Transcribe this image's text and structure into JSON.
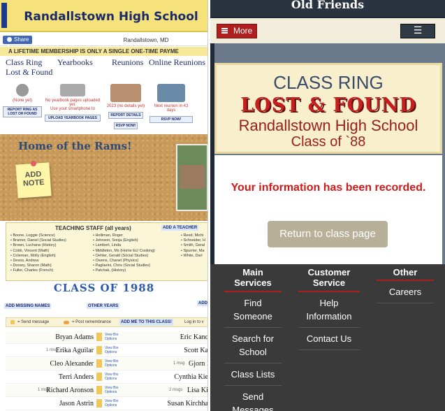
{
  "left": {
    "title": "Randallstown High School",
    "share_label": "Share 0",
    "city": "Randallstown, MD",
    "lifetime": "A LIFETIME MEMBERSHIP IS ONLY A SINGLE ONE-TIME PAYME",
    "nav": [
      "Class Ring",
      "Lost & Found",
      "Yearbooks",
      "Reunions",
      "Online Reunions"
    ],
    "icons": [
      {
        "caption": "(None yet)",
        "button": "REPORT RING AS LOST OR FOUND"
      },
      {
        "caption": "No yearbook pages uploaded yet.",
        "caption2": "Use your smartphone to",
        "button": "UPLOAD YEARBOOK PAGES"
      },
      {
        "caption": "2023 (no details yet)",
        "button": "REPORT DETAILS",
        "button2": "RSVP NOW!"
      },
      {
        "caption": "Next reunion in 43 days",
        "button": "RSVP NOW!"
      }
    ],
    "home_title": "Home of the Rams!",
    "add_note": "ADD NOTE",
    "teaching_title": "TEACHING STAFF (all years)",
    "add_teacher": "ADD A TEACHER",
    "teachers_col1": [
      "• Boone, Leggie (Science)",
      "• Bramer, Daniel (Social Studies)",
      "• Brown, Luchana (History)",
      "• Cobb, Vincent (Math)",
      "• Coleman, Molly (English)",
      "• Devos, Andrew",
      "• Dorsey, Sharon (Math)",
      "• Fuller, Charles (French)"
    ],
    "teachers_col2": [
      "• Holliman, Roger",
      "• Johnson, Sonja (English)",
      "• Lambert, Linda",
      "• Middleton, Ms (Home Ec/ Cooking)",
      "• Oehler, Gerald (Social Studies)",
      "• Owens, Chanel (Physics)",
      "• Pagliarini, Chris (Social Studies)",
      "• Patchak, (History)"
    ],
    "teachers_col3": [
      "• Reed, Michi",
      "• Schneider, H",
      "• Smith, Geral",
      "• Spurrier, Ma",
      "• White, Darl"
    ],
    "class_title": "CLASS OF 1988",
    "add_missing": "ADD MISSING NAMES",
    "other_years": "OTHER YEARS",
    "add_short": "ADD",
    "legend_send": "= Send message",
    "legend_post": "= Post remembrance",
    "legend_add_me": "ADD ME TO THIS CLASS!",
    "legend_login": "Log in to v",
    "view_bio": "View Bio",
    "options": "Options",
    "rows": [
      {
        "msg": "",
        "name": "Bryan Adams",
        "msg2": "",
        "name2": "Eric Kanc"
      },
      {
        "msg": "1 msg",
        "name": "Erika Aguilar",
        "msg2": "",
        "name2": "Scott Ka"
      },
      {
        "msg": "",
        "name": "Cleo Alexander",
        "msg2": "1 msg",
        "name2": "Gjorn K"
      },
      {
        "msg": "",
        "name": "Terri Anders",
        "msg2": "",
        "name2": "Cynthia Kie"
      },
      {
        "msg": "1 msg",
        "name": "Richard Aronson",
        "msg2": "2 msgs",
        "name2": "Lisa Kir"
      },
      {
        "msg": "",
        "name": "Jason Astrin",
        "msg2": "",
        "name2": "Susan Kirchha"
      }
    ]
  },
  "right": {
    "site_title": "Old Friends",
    "more_label": "More",
    "menu_icon": "hamburger-icon",
    "class_ring": "CLASS RING",
    "lost_found": "LOST & FOUND",
    "school": "Randallstown High School",
    "class_of": "Class of `88",
    "recorded": "Your information has been recorded.",
    "return_btn": "Return to class page",
    "footer": {
      "col1_title": "Main Services",
      "col1": [
        "Find Someone",
        "Search for School",
        "Class Lists",
        "Send Messages"
      ],
      "col2_title": "Customer Service",
      "col2": [
        "Help Information",
        "Contact Us"
      ],
      "col3_title": "Other",
      "col3": [
        "Careers"
      ]
    },
    "accent": "#b01f1f"
  }
}
